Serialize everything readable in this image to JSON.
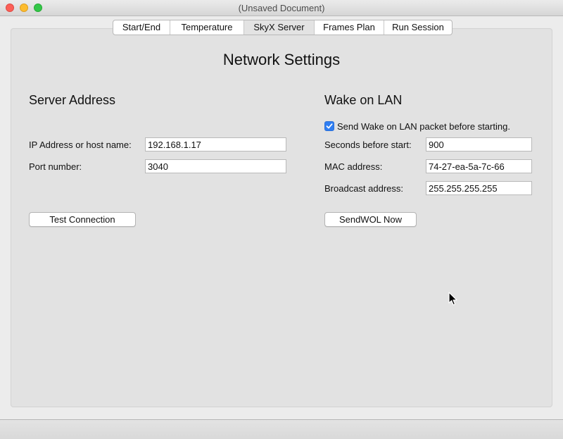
{
  "window": {
    "title": "(Unsaved Document)"
  },
  "tabs": [
    {
      "label": "Start/End"
    },
    {
      "label": "Temperature"
    },
    {
      "label": "SkyX Server",
      "selected": true
    },
    {
      "label": "Frames Plan"
    },
    {
      "label": "Run Session"
    }
  ],
  "page": {
    "heading": "Network Settings"
  },
  "server": {
    "section_title": "Server Address",
    "ip_label": "IP Address or host name:",
    "ip_value": "192.168.1.17",
    "port_label": "Port number:",
    "port_value": "3040",
    "test_button": "Test Connection"
  },
  "wol": {
    "section_title": "Wake on LAN",
    "checkbox_label": "Send Wake on LAN packet before starting.",
    "checkbox_checked": true,
    "seconds_label": "Seconds before start:",
    "seconds_value": "900",
    "mac_label": "MAC address:",
    "mac_value": "74-27-ea-5a-7c-66",
    "broadcast_label": "Broadcast address:",
    "broadcast_value": "255.255.255.255",
    "send_button": "SendWOL Now"
  },
  "icons": {
    "close": "close-dot",
    "minimize": "minimize-dot",
    "zoom": "zoom-dot",
    "checkmark": "checkmark-icon",
    "cursor": "arrow-cursor-icon"
  },
  "colors": {
    "accent": "#2f7ef2",
    "close": "#fc5f57",
    "minimize": "#fdbc2e",
    "zoom": "#33c748"
  }
}
